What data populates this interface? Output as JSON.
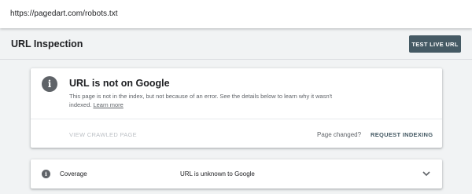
{
  "address_bar": {
    "url": "https://pagedart.com/robots.txt"
  },
  "header": {
    "title": "URL Inspection",
    "test_live_label": "TEST LIVE URL"
  },
  "status_card": {
    "icon": "info-icon",
    "heading": "URL is not on Google",
    "description": "This page is not in the index, but not because of an error. See the details below to learn why it wasn't indexed.",
    "learn_more": "Learn more",
    "view_crawled_label": "VIEW CRAWLED PAGE",
    "page_changed": "Page changed?",
    "request_indexing_label": "REQUEST INDEXING"
  },
  "coverage": {
    "icon": "info-icon",
    "label": "Coverage",
    "status": "URL is unknown to Google",
    "expand_icon": "chevron-down-icon"
  },
  "colors": {
    "accent": "#455a64",
    "background": "#f1f3f4",
    "card": "#ffffff",
    "icon_gray": "#5f6368",
    "disabled_text": "#bdc1c6"
  }
}
